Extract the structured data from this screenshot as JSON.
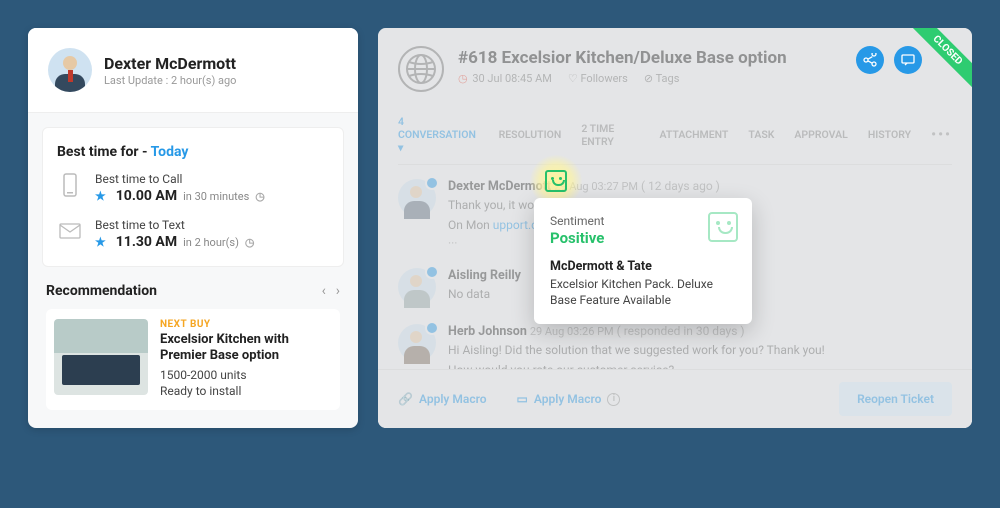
{
  "contact": {
    "name": "Dexter McDermott",
    "last_update": "Last Update : 2 hour(s) ago"
  },
  "best_time": {
    "heading_prefix": "Best time for - ",
    "heading_day": "Today",
    "call": {
      "label": "Best time to Call",
      "time": "10.00 AM",
      "rel": "in 30 minutes"
    },
    "text": {
      "label": "Best time to Text",
      "time": "11.30 AM",
      "rel": "in 2 hour(s)"
    }
  },
  "reco": {
    "heading": "Recommendation",
    "tag": "NEXT BUY",
    "title": "Excelsior Kitchen with Premier  Base option",
    "qty": "1500-2000 units",
    "status": "Ready to install"
  },
  "ticket": {
    "closed": "CLOSED",
    "title": "#618 Excelsior Kitchen/Deluxe Base option",
    "due": "30 Jul 08:45 AM",
    "followers": "Followers",
    "tags": "Tags",
    "tabs": {
      "conversation": "4 CONVERSATION",
      "resolution": "RESOLUTION",
      "time_entry": "2 TIME ENTRY",
      "attachment": "ATTACHMENT",
      "task": "TASK",
      "approval": "APPROVAL",
      "history": "HISTORY"
    }
  },
  "conv": [
    {
      "name": "Dexter McDermott",
      "time": "29 Aug 03:27 PM",
      "ago": "( 12 days ago )",
      "txt": "Thank you, it worked!",
      "extra": "On Mon",
      "link": "upport.com >",
      "dots": "···"
    },
    {
      "name": "Aisling Reilly",
      "time": "",
      "ago": "",
      "txt": "No data"
    },
    {
      "name": "Herb Johnson",
      "time": "29 Aug 03:26 PM",
      "ago": "( responded in 30 days )",
      "txt": "Hi Aisling! Did the solution that we suggested work for you? Thank you!",
      "txt2": "How would you rate our customer service?"
    }
  ],
  "footer": {
    "apply_macro": "Apply Macro",
    "reopen": "Reopen Ticket"
  },
  "sentiment": {
    "label": "Sentiment",
    "value": "Positive",
    "company": "McDermott & Tate",
    "desc": "Excelsior Kitchen Pack. Deluxe Base Feature Available"
  }
}
